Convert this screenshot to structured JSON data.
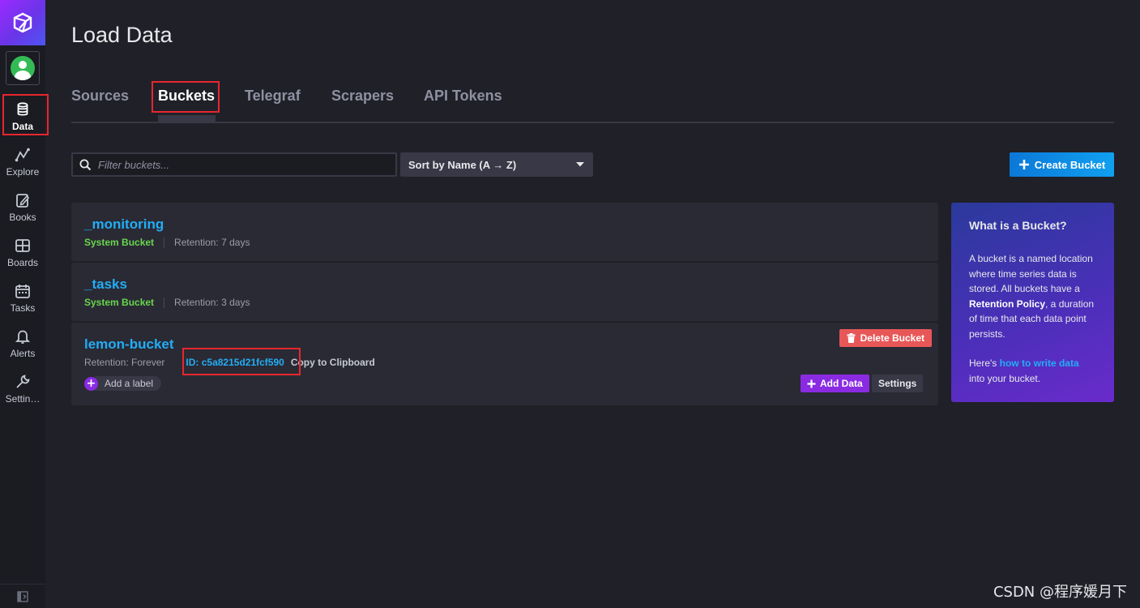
{
  "page": {
    "title": "Load Data"
  },
  "sidebar": {
    "items": [
      {
        "label": "Data",
        "icon": "database-icon",
        "active": true
      },
      {
        "label": "Explore",
        "icon": "graph-icon"
      },
      {
        "label": "Books",
        "icon": "notebook-icon"
      },
      {
        "label": "Boards",
        "icon": "dashboard-icon"
      },
      {
        "label": "Tasks",
        "icon": "calendar-icon"
      },
      {
        "label": "Alerts",
        "icon": "bell-icon"
      },
      {
        "label": "Settin…",
        "icon": "wrench-icon"
      }
    ]
  },
  "tabs": [
    {
      "label": "Sources"
    },
    {
      "label": "Buckets",
      "active": true
    },
    {
      "label": "Telegraf"
    },
    {
      "label": "Scrapers"
    },
    {
      "label": "API Tokens"
    }
  ],
  "toolbar": {
    "filter_placeholder": "Filter buckets...",
    "sort_label": "Sort by Name (A → Z)",
    "create_label": "Create Bucket"
  },
  "buckets": [
    {
      "name": "_monitoring",
      "type": "System Bucket",
      "retention": "Retention: 7 days"
    },
    {
      "name": "_tasks",
      "type": "System Bucket",
      "retention": "Retention: 3 days"
    },
    {
      "name": "lemon-bucket",
      "retention": "Retention: Forever",
      "id": "ID: c5a8215d21fcf590",
      "copy": "Copy to Clipboard",
      "add_label": "Add a label",
      "delete_label": "Delete Bucket",
      "add_data_label": "Add Data",
      "settings_label": "Settings"
    }
  ],
  "info": {
    "title": "What is a Bucket?",
    "p1_a": "A bucket is a named location where time series data is stored. All buckets have a ",
    "p1_bold": "Retention Policy",
    "p1_b": ", a duration of time that each data point persists.",
    "p2_a": "Here's ",
    "p2_link": "how to write data",
    "p2_b": " into your bucket."
  },
  "watermark": "CSDN @程序媛月下",
  "colors": {
    "accent": "#22adf6",
    "system": "#67d74e",
    "danger": "#e85757",
    "purple": "#8a2be2"
  }
}
